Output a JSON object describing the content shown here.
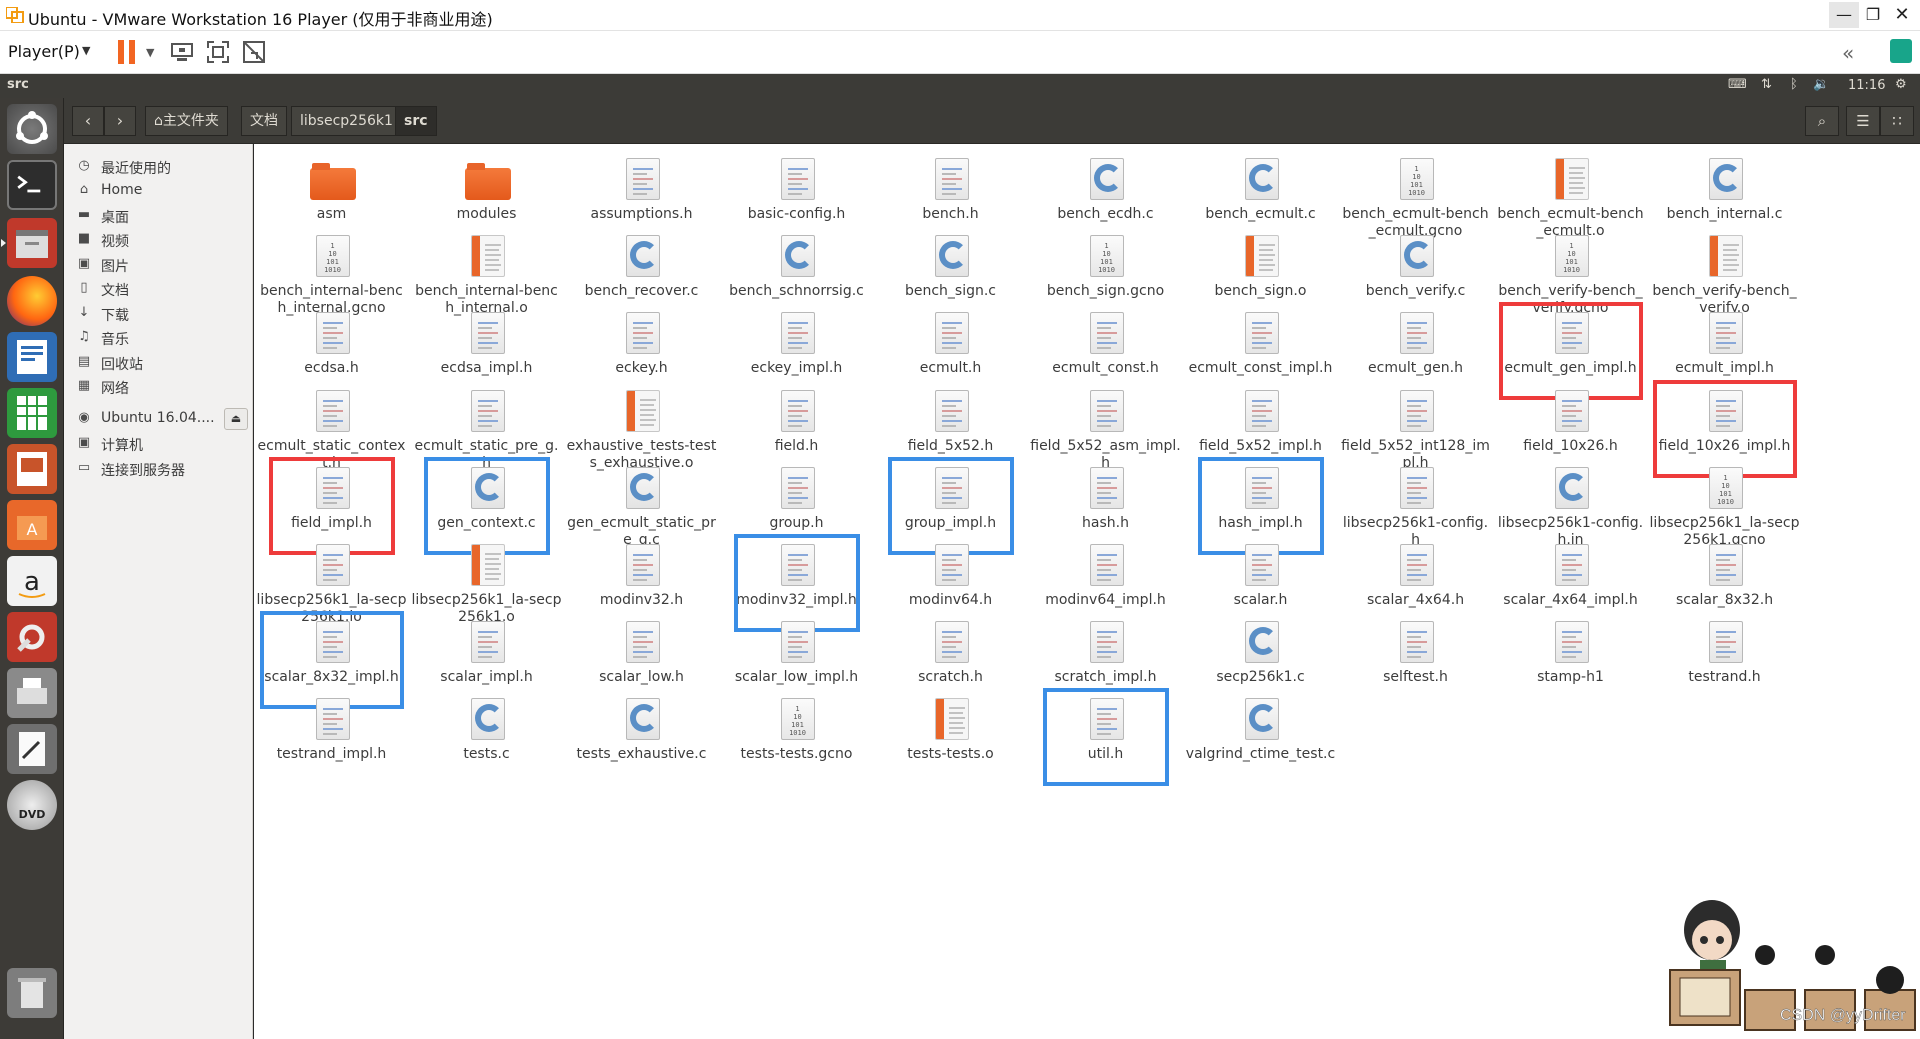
{
  "vmware": {
    "title": "Ubuntu - VMware Workstation 16 Player (仅用于非商业用途)",
    "player_menu": "Player(P)"
  },
  "panel": {
    "app_name": "src",
    "clock": "11:16"
  },
  "breadcrumbs": [
    "主文件夹",
    "文档",
    "libsecp256k1",
    "src"
  ],
  "sidebar": {
    "items": [
      {
        "icon": "clock-icon",
        "label": "最近使用的"
      },
      {
        "icon": "home-icon",
        "label": "Home"
      },
      {
        "icon": "desktop-icon",
        "label": "桌面"
      },
      {
        "icon": "video-icon",
        "label": "视频"
      },
      {
        "icon": "camera-icon",
        "label": "图片"
      },
      {
        "icon": "document-icon",
        "label": "文档"
      },
      {
        "icon": "download-icon",
        "label": "下载"
      },
      {
        "icon": "music-icon",
        "label": "音乐"
      },
      {
        "icon": "trash-icon",
        "label": "回收站"
      },
      {
        "icon": "network-icon",
        "label": "网络"
      }
    ],
    "devices": [
      {
        "icon": "disc-icon",
        "label": "Ubuntu 16.04...."
      },
      {
        "icon": "computer-icon",
        "label": "计算机"
      },
      {
        "icon": "server-icon",
        "label": "连接到服务器"
      }
    ]
  },
  "files": [
    {
      "name": "asm",
      "type": "folder"
    },
    {
      "name": "modules",
      "type": "folder"
    },
    {
      "name": "assumptions.h",
      "type": "h"
    },
    {
      "name": "basic-config.h",
      "type": "h"
    },
    {
      "name": "bench.h",
      "type": "h"
    },
    {
      "name": "bench_ecdh.c",
      "type": "c"
    },
    {
      "name": "bench_ecmult.c",
      "type": "c"
    },
    {
      "name": "bench_ecmult-bench_ecmult.gcno",
      "type": "gcno"
    },
    {
      "name": "bench_ecmult-bench_ecmult.o",
      "type": "o"
    },
    {
      "name": "bench_internal.c",
      "type": "c"
    },
    {
      "name": "bench_internal-bench_internal.gcno",
      "type": "gcno"
    },
    {
      "name": "bench_internal-bench_internal.o",
      "type": "o"
    },
    {
      "name": "bench_recover.c",
      "type": "c"
    },
    {
      "name": "bench_schnorrsig.c",
      "type": "c"
    },
    {
      "name": "bench_sign.c",
      "type": "c"
    },
    {
      "name": "bench_sign.gcno",
      "type": "gcno"
    },
    {
      "name": "bench_sign.o",
      "type": "o"
    },
    {
      "name": "bench_verify.c",
      "type": "c"
    },
    {
      "name": "bench_verify-bench_verify.gcno",
      "type": "gcno"
    },
    {
      "name": "bench_verify-bench_verify.o",
      "type": "o"
    },
    {
      "name": "ecdsa.h",
      "type": "h"
    },
    {
      "name": "ecdsa_impl.h",
      "type": "h"
    },
    {
      "name": "eckey.h",
      "type": "h"
    },
    {
      "name": "eckey_impl.h",
      "type": "h"
    },
    {
      "name": "ecmult.h",
      "type": "h"
    },
    {
      "name": "ecmult_const.h",
      "type": "h"
    },
    {
      "name": "ecmult_const_impl.h",
      "type": "h"
    },
    {
      "name": "ecmult_gen.h",
      "type": "h"
    },
    {
      "name": "ecmult_gen_impl.h",
      "type": "h"
    },
    {
      "name": "ecmult_impl.h",
      "type": "h"
    },
    {
      "name": "ecmult_static_context.h",
      "type": "h"
    },
    {
      "name": "ecmult_static_pre_g.h",
      "type": "h"
    },
    {
      "name": "exhaustive_tests-tests_exhaustive.o",
      "type": "o"
    },
    {
      "name": "field.h",
      "type": "h"
    },
    {
      "name": "field_5x52.h",
      "type": "h"
    },
    {
      "name": "field_5x52_asm_impl.h",
      "type": "h"
    },
    {
      "name": "field_5x52_impl.h",
      "type": "h"
    },
    {
      "name": "field_5x52_int128_impl.h",
      "type": "h"
    },
    {
      "name": "field_10x26.h",
      "type": "h"
    },
    {
      "name": "field_10x26_impl.h",
      "type": "h"
    },
    {
      "name": "field_impl.h",
      "type": "h"
    },
    {
      "name": "gen_context.c",
      "type": "c"
    },
    {
      "name": "gen_ecmult_static_pre_g.c",
      "type": "c"
    },
    {
      "name": "group.h",
      "type": "h"
    },
    {
      "name": "group_impl.h",
      "type": "h"
    },
    {
      "name": "hash.h",
      "type": "h"
    },
    {
      "name": "hash_impl.h",
      "type": "h"
    },
    {
      "name": "libsecp256k1-config.h",
      "type": "h"
    },
    {
      "name": "libsecp256k1-config.h.in",
      "type": "c"
    },
    {
      "name": "libsecp256k1_la-secp256k1.gcno",
      "type": "gcno"
    },
    {
      "name": "libsecp256k1_la-secp256k1.lo",
      "type": "h"
    },
    {
      "name": "libsecp256k1_la-secp256k1.o",
      "type": "o"
    },
    {
      "name": "modinv32.h",
      "type": "h"
    },
    {
      "name": "modinv32_impl.h",
      "type": "h"
    },
    {
      "name": "modinv64.h",
      "type": "h"
    },
    {
      "name": "modinv64_impl.h",
      "type": "h"
    },
    {
      "name": "scalar.h",
      "type": "h"
    },
    {
      "name": "scalar_4x64.h",
      "type": "h"
    },
    {
      "name": "scalar_4x64_impl.h",
      "type": "h"
    },
    {
      "name": "scalar_8x32.h",
      "type": "h"
    },
    {
      "name": "scalar_8x32_impl.h",
      "type": "h"
    },
    {
      "name": "scalar_impl.h",
      "type": "h"
    },
    {
      "name": "scalar_low.h",
      "type": "h"
    },
    {
      "name": "scalar_low_impl.h",
      "type": "h"
    },
    {
      "name": "scratch.h",
      "type": "h"
    },
    {
      "name": "scratch_impl.h",
      "type": "h"
    },
    {
      "name": "secp256k1.c",
      "type": "c"
    },
    {
      "name": "selftest.h",
      "type": "h"
    },
    {
      "name": "stamp-h1",
      "type": "h"
    },
    {
      "name": "testrand.h",
      "type": "h"
    },
    {
      "name": "testrand_impl.h",
      "type": "h"
    },
    {
      "name": "tests.c",
      "type": "c"
    },
    {
      "name": "tests_exhaustive.c",
      "type": "c"
    },
    {
      "name": "tests-tests.gcno",
      "type": "gcno"
    },
    {
      "name": "tests-tests.o",
      "type": "o"
    },
    {
      "name": "util.h",
      "type": "h"
    },
    {
      "name": "valgrind_ctime_test.c",
      "type": "c"
    }
  ],
  "highlights": {
    "red": [
      "ecmult_gen_impl.h",
      "field_10x26_impl.h",
      "field_impl.h"
    ],
    "blue": [
      "gen_context.c",
      "group_impl.h",
      "hash_impl.h",
      "modinv32_impl.h",
      "scalar_8x32_impl.h",
      "util.h"
    ]
  },
  "colors": {
    "highlight_red": "#ee3b3b",
    "highlight_blue": "#3a8ee6",
    "folder_orange": "#e8662a"
  },
  "watermark": "CSDN @yyDrifter"
}
